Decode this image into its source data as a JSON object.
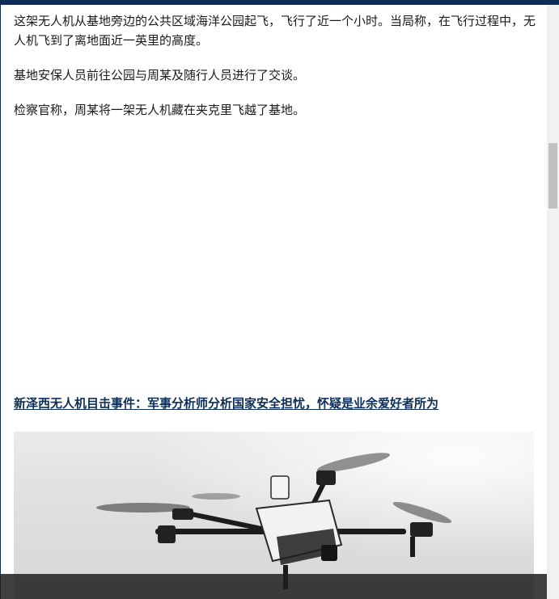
{
  "article": {
    "paragraphs": [
      "这架无人机从基地旁边的公共区域海洋公园起飞，飞行了近一个小时。当局称，在飞行过程中，无人机飞到了离地面近一英里的高度。",
      "基地安保人员前往公园与周某及随行人员进行了交谈。",
      "检察官称，周某将一架无人机藏在夹克里飞越了基地。"
    ],
    "related_link": "新泽西无人机目击事件：军事分析师分析国家安全担忧，怀疑是业余爱好者所为"
  },
  "photo": {
    "subject": "drone-photo"
  },
  "colors": {
    "brand": "#0c2d57",
    "text": "#1a1a1a"
  }
}
